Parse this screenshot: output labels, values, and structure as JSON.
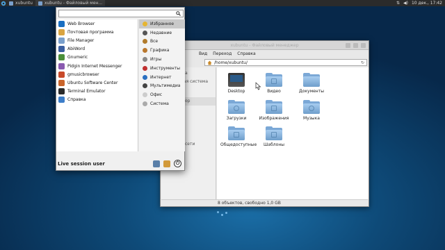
{
  "panel": {
    "tasks": [
      {
        "label": "xubuntu",
        "active": false
      },
      {
        "label": "xubuntu - Файловый мен...",
        "active": true
      }
    ],
    "clock": "10 дек., 17:42"
  },
  "menu": {
    "search": {
      "value": "",
      "placeholder": ""
    },
    "apps": [
      {
        "label": "Web Browser",
        "icon": "web-browser-icon",
        "color": "#1a6fc2"
      },
      {
        "label": "Почтовая программа",
        "icon": "mail-icon",
        "color": "#d9a441"
      },
      {
        "label": "File Manager",
        "icon": "file-manager-icon",
        "color": "#7aa0cc"
      },
      {
        "label": "AbiWord",
        "icon": "abiword-icon",
        "color": "#3b5fa0"
      },
      {
        "label": "Gnumeric",
        "icon": "gnumeric-icon",
        "color": "#4b8f3a"
      },
      {
        "label": "Pidgin Internet Messenger",
        "icon": "pidgin-icon",
        "color": "#8a5ab0"
      },
      {
        "label": "gmusicbrowser",
        "icon": "gmusicbrowser-icon",
        "color": "#c84a2a"
      },
      {
        "label": "Ubuntu Software Center",
        "icon": "software-center-icon",
        "color": "#c9642a"
      },
      {
        "label": "Terminal Emulator",
        "icon": "terminal-icon",
        "color": "#2b2b2b"
      },
      {
        "label": "Справка",
        "icon": "help-icon",
        "color": "#3d7ec9"
      }
    ],
    "categories": [
      {
        "label": "Избранное",
        "icon": "favorites-icon",
        "color": "#e6b531",
        "selected": true
      },
      {
        "label": "Недавние",
        "icon": "recent-icon",
        "color": "#555555",
        "selected": false
      },
      {
        "label": "Все",
        "icon": "all-icon",
        "color": "#b07a2a",
        "selected": false
      },
      {
        "label": "Графика",
        "icon": "graphics-icon",
        "color": "#b9772d",
        "selected": false
      },
      {
        "label": "Игры",
        "icon": "games-icon",
        "color": "#888888",
        "selected": false
      },
      {
        "label": "Инструменты",
        "icon": "tools-icon",
        "color": "#c03030",
        "selected": false
      },
      {
        "label": "Интернет",
        "icon": "internet-icon",
        "color": "#2a6fc0",
        "selected": false
      },
      {
        "label": "Мультимедиа",
        "icon": "multimedia-icon",
        "color": "#444444",
        "selected": false
      },
      {
        "label": "Офис",
        "icon": "office-icon",
        "color": "#cccccc",
        "selected": false
      },
      {
        "label": "Система",
        "icon": "system-icon",
        "color": "#aaaaaa",
        "selected": false
      }
    ],
    "user": "Live session user"
  },
  "filemanager": {
    "title": "xubuntu - Файловый менеджер",
    "menu": [
      "Вид",
      "Переход",
      "Справка"
    ],
    "path": "/home/xubuntu/",
    "sidebar": [
      "а",
      "ная система",
      "op",
      "сети"
    ],
    "items": [
      {
        "label": "Desktop",
        "kind": "desktop"
      },
      {
        "label": "Видео",
        "kind": "folder"
      },
      {
        "label": "Документы",
        "kind": "folder"
      },
      {
        "label": "Загрузки",
        "kind": "folder"
      },
      {
        "label": "Изображения",
        "kind": "folder"
      },
      {
        "label": "Музыка",
        "kind": "folder"
      },
      {
        "label": "Общедоступные",
        "kind": "folder"
      },
      {
        "label": "Шаблоны",
        "kind": "folder"
      }
    ],
    "status": "8 объектов, свободно 1,0 GB"
  }
}
